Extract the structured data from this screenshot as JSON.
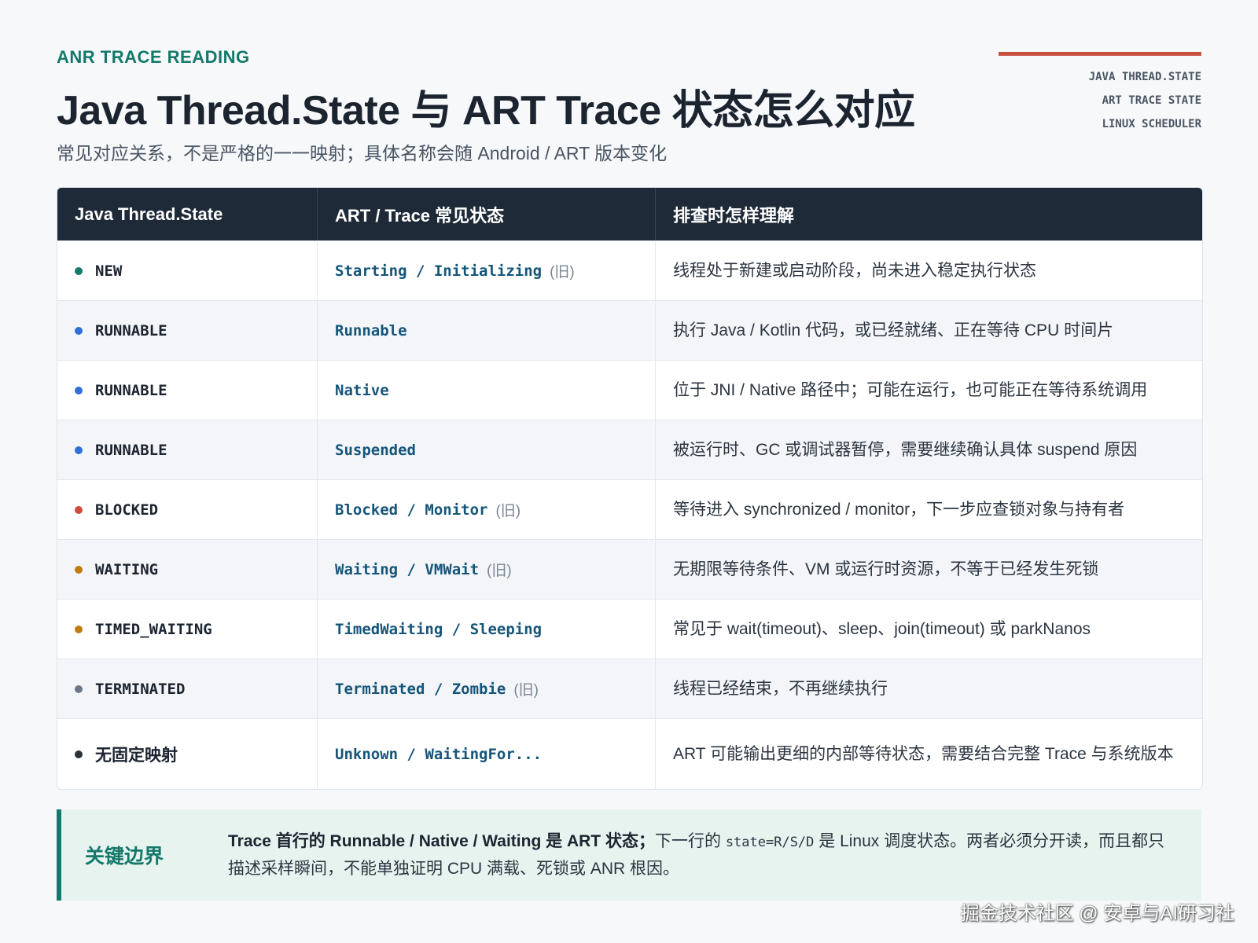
{
  "header": {
    "kicker": "ANR TRACE READING",
    "title": "Java Thread.State 与 ART Trace 状态怎么对应",
    "subtitle": "常见对应关系，不是严格的一一映射；具体名称会随 Android / ART 版本变化",
    "tags": [
      "JAVA THREAD.STATE",
      "ART TRACE STATE",
      "LINUX SCHEDULER"
    ],
    "accent_color": "#c8503f"
  },
  "table": {
    "columns": [
      "Java Thread.State",
      "ART / Trace 常见状态",
      "排查时怎样理解"
    ],
    "rows": [
      {
        "java": "NEW",
        "dot": "#13796a",
        "art": "Starting / Initializing",
        "old": "(旧)",
        "desc": "线程处于新建或启动阶段，尚未进入稳定执行状态"
      },
      {
        "java": "RUNNABLE",
        "dot": "#2f6fd6",
        "art": "Runnable",
        "old": "",
        "desc": "执行 Java / Kotlin 代码，或已经就绪、正在等待 CPU 时间片"
      },
      {
        "java": "RUNNABLE",
        "dot": "#2f6fd6",
        "art": "Native",
        "old": "",
        "desc": "位于 JNI / Native 路径中；可能在运行，也可能正在等待系统调用"
      },
      {
        "java": "RUNNABLE",
        "dot": "#2f6fd6",
        "art": "Suspended",
        "old": "",
        "desc": "被运行时、GC 或调试器暂停，需要继续确认具体 suspend 原因"
      },
      {
        "java": "BLOCKED",
        "dot": "#cf4a3c",
        "art": "Blocked / Monitor",
        "old": "(旧)",
        "desc": "等待进入 synchronized / monitor，下一步应查锁对象与持有者"
      },
      {
        "java": "WAITING",
        "dot": "#c07a12",
        "art": "Waiting / VMWait",
        "old": "(旧)",
        "desc": "无期限等待条件、VM 或运行时资源，不等于已经发生死锁"
      },
      {
        "java": "TIMED_WAITING",
        "dot": "#c07a12",
        "art": "TimedWaiting / Sleeping",
        "old": "",
        "desc": "常见于 wait(timeout)、sleep、join(timeout) 或 parkNanos"
      },
      {
        "java": "TERMINATED",
        "dot": "#6b7686",
        "art": "Terminated / Zombie",
        "old": "(旧)",
        "desc": "线程已经结束，不再继续执行"
      },
      {
        "java": "无固定映射",
        "dot": "#2a3138",
        "art": "Unknown / WaitingFor...",
        "old": "",
        "desc": "ART 可能输出更细的内部等待状态，需要结合完整 Trace 与系统版本"
      }
    ]
  },
  "callout": {
    "label": "关键边界",
    "bold": "Trace 首行的 Runnable / Native / Waiting 是 ART 状态；",
    "text_a": "下一行的 ",
    "code": "state=R/S/D",
    "text_b": " 是 Linux 调度状态。两者必须分开读，而且都只描述采样瞬间，不能单独证明 CPU 满载、死锁或 ANR 根因。"
  },
  "watermark": "掘金技术社区 @ 安卓与AI研习社"
}
